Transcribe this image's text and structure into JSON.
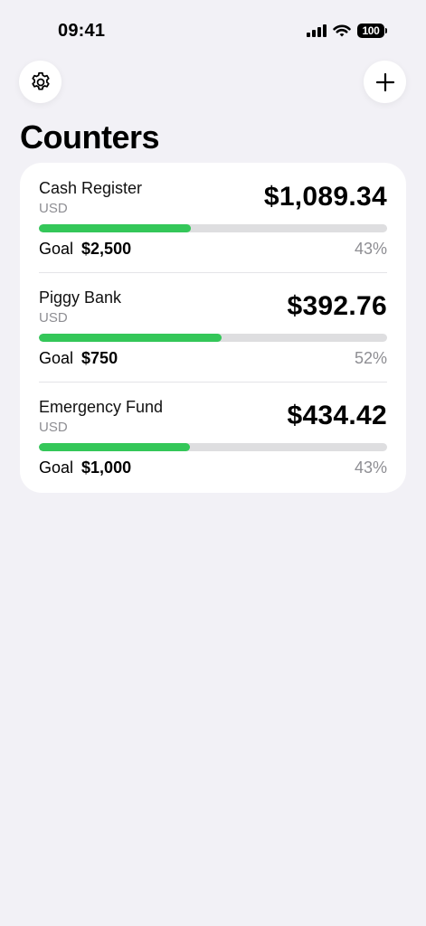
{
  "status_bar": {
    "time": "09:41",
    "battery": "100"
  },
  "header": {
    "settings_icon": "gear-icon",
    "add_icon": "plus-icon",
    "title": "Counters"
  },
  "colors": {
    "accent_green": "#34c759",
    "background": "#f2f1f6"
  },
  "counters": [
    {
      "name": "Cash Register",
      "currency": "USD",
      "amount": "$1,089.34",
      "goal_label": "Goal",
      "goal": "$2,500",
      "percent": "43%",
      "progress": 0.436
    },
    {
      "name": "Piggy Bank",
      "currency": "USD",
      "amount": "$392.76",
      "goal_label": "Goal",
      "goal": "$750",
      "percent": "52%",
      "progress": 0.524
    },
    {
      "name": "Emergency Fund",
      "currency": "USD",
      "amount": "$434.42",
      "goal_label": "Goal",
      "goal": "$1,000",
      "percent": "43%",
      "progress": 0.434
    }
  ]
}
